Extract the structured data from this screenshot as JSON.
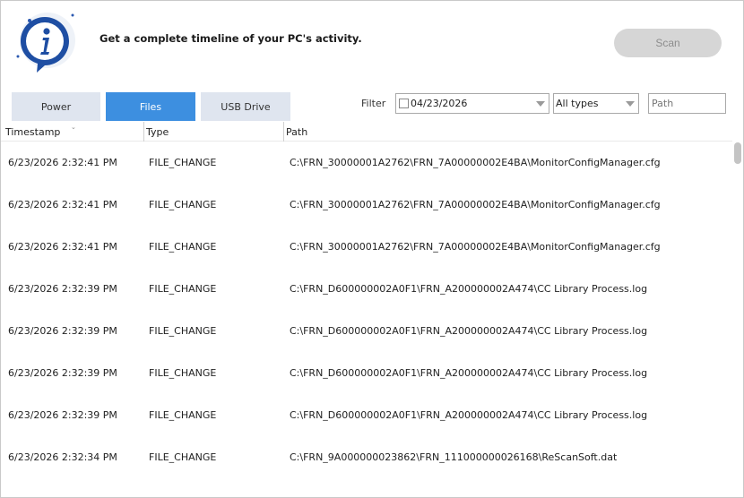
{
  "header": {
    "headline": "Get a complete timeline of your PC's activity.",
    "scan_label": "Scan",
    "logo_icon": "info-icon"
  },
  "tabs": [
    {
      "label": "Power",
      "active": false
    },
    {
      "label": "Files",
      "active": true
    },
    {
      "label": "USB Drive",
      "active": false
    }
  ],
  "filter": {
    "label": "Filter",
    "date_value": "04/23/2026",
    "date_checked": false,
    "type_value": "All types",
    "path_placeholder": "Path"
  },
  "table": {
    "columns": [
      "Timestamp",
      "Type",
      "Path"
    ],
    "rows": [
      {
        "timestamp": "6/23/2026 2:32:41 PM",
        "type": "FILE_CHANGE",
        "path": "C:\\FRN_30000001A2762\\FRN_7A00000002E4BA\\MonitorConfigManager.cfg"
      },
      {
        "timestamp": "6/23/2026 2:32:41 PM",
        "type": "FILE_CHANGE",
        "path": "C:\\FRN_30000001A2762\\FRN_7A00000002E4BA\\MonitorConfigManager.cfg"
      },
      {
        "timestamp": "6/23/2026 2:32:41 PM",
        "type": "FILE_CHANGE",
        "path": "C:\\FRN_30000001A2762\\FRN_7A00000002E4BA\\MonitorConfigManager.cfg"
      },
      {
        "timestamp": "6/23/2026 2:32:39 PM",
        "type": "FILE_CHANGE",
        "path": "C:\\FRN_D600000002A0F1\\FRN_A200000002A474\\CC Library Process.log"
      },
      {
        "timestamp": "6/23/2026 2:32:39 PM",
        "type": "FILE_CHANGE",
        "path": "C:\\FRN_D600000002A0F1\\FRN_A200000002A474\\CC Library Process.log"
      },
      {
        "timestamp": "6/23/2026 2:32:39 PM",
        "type": "FILE_CHANGE",
        "path": "C:\\FRN_D600000002A0F1\\FRN_A200000002A474\\CC Library Process.log"
      },
      {
        "timestamp": "6/23/2026 2:32:39 PM",
        "type": "FILE_CHANGE",
        "path": "C:\\FRN_D600000002A0F1\\FRN_A200000002A474\\CC Library Process.log"
      },
      {
        "timestamp": "6/23/2026 2:32:34 PM",
        "type": "FILE_CHANGE",
        "path": "C:\\FRN_9A000000023862\\FRN_111000000026168\\ReScanSoft.dat"
      }
    ]
  },
  "colors": {
    "accent": "#3d8fe0",
    "tab_inactive": "#dfe5ef",
    "logo_blue": "#1e4ea3",
    "scan_disabled": "#d6d6d6"
  }
}
